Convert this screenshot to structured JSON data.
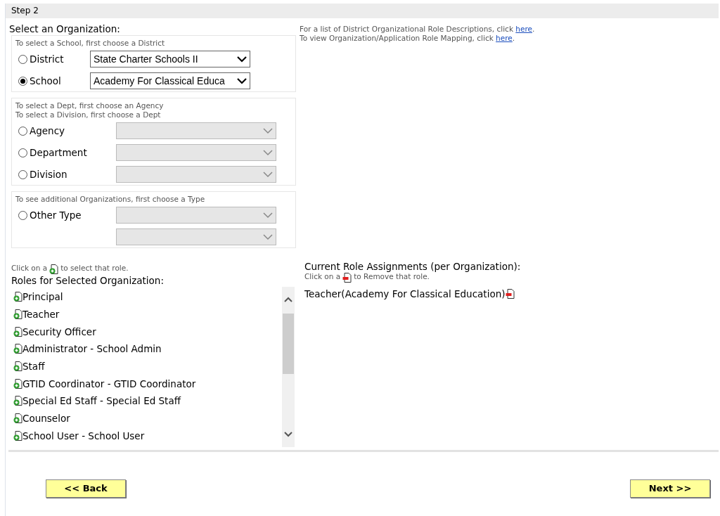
{
  "step_title": "Step 2",
  "org_heading": "Select an Organization:",
  "groups": [
    {
      "hints": [
        "To select a School, first choose a District"
      ],
      "rows": [
        {
          "label": "District",
          "selected": false,
          "select": {
            "value": "State Charter Schools II",
            "disabled": false
          }
        },
        {
          "label": "School",
          "selected": true,
          "select": {
            "value": "Academy For Classical Educa",
            "disabled": false
          }
        }
      ]
    },
    {
      "hints": [
        "To select a Dept, first choose an Agency",
        "To select a Division, first choose a Dept"
      ],
      "rows": [
        {
          "label": "Agency",
          "selected": false,
          "select": {
            "disabled": true
          }
        },
        {
          "label": "Department",
          "selected": false,
          "select": {
            "disabled": true
          }
        },
        {
          "label": "Division",
          "selected": false,
          "select": {
            "disabled": true
          }
        }
      ]
    },
    {
      "hints": [
        "To see additional Organizations, first choose a Type"
      ],
      "rows": [
        {
          "label": "Other Type",
          "selected": false,
          "select": {
            "disabled": true
          }
        },
        {
          "select": {
            "disabled": true
          }
        }
      ]
    }
  ],
  "info_lines": [
    {
      "before": "For a list of District Organizational Role Descriptions, click ",
      "link": "here",
      "after": "."
    },
    {
      "before": "To view Organization/Application Role Mapping, click ",
      "link": "here",
      "after": "."
    }
  ],
  "roles": {
    "hint_before": "Click on a",
    "hint_after": "to select that role.",
    "heading": "Roles for Selected Organization:",
    "items": [
      "Principal",
      "Teacher",
      "Security Officer",
      "Administrator - School Admin",
      "Staff",
      "GTID Coordinator - GTID Coordinator",
      "Special Ed Staff - Special Ed Staff",
      "Counselor",
      "School User - School User"
    ]
  },
  "current": {
    "heading": "Current Role Assignments (per Organization):",
    "hint_before": "Click on a",
    "hint_after": "to Remove that role.",
    "items": [
      "Teacher(Academy For Classical Education)"
    ]
  },
  "buttons": {
    "back": "<< Back",
    "next": "Next >>"
  }
}
